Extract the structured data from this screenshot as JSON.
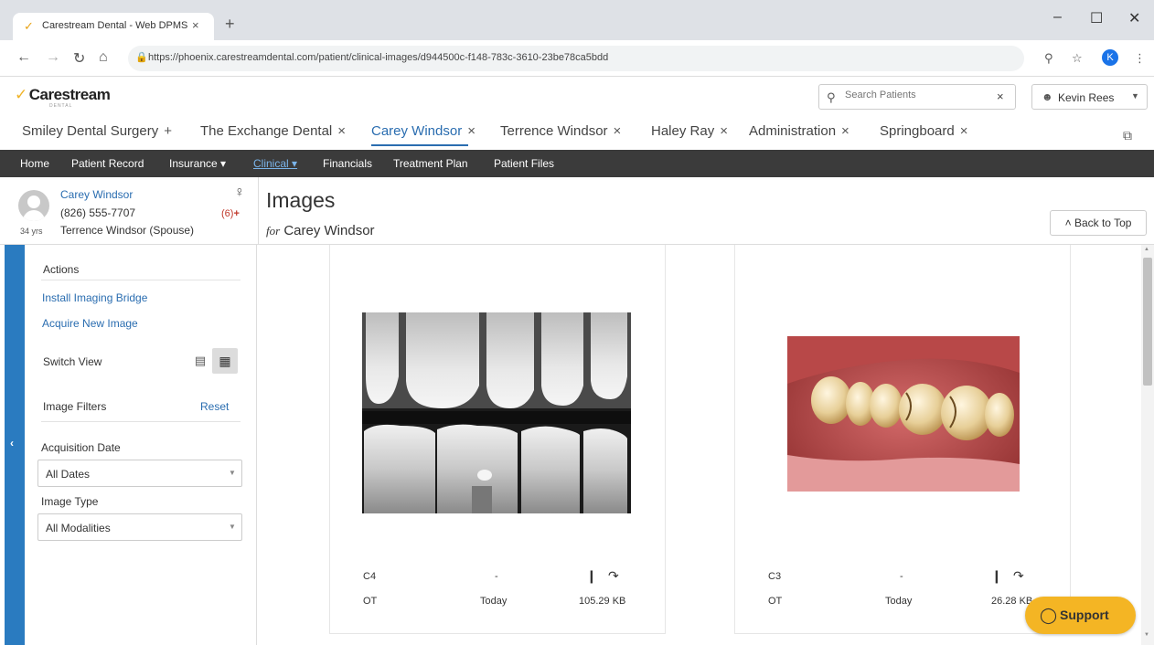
{
  "browser": {
    "tab_title": "Carestream Dental - Web DPMS",
    "tab_close": "×",
    "new_tab": "+",
    "url": "https://phoenix.carestreamdental.com/patient/clinical-images/d944500c-f148-783c-3610-23be78ca5bdd",
    "profile_initial": "K",
    "minimize": "–",
    "maximize": "☐",
    "close": "✕"
  },
  "header": {
    "logo_text": "Carestream",
    "logo_sub": "DENTAL",
    "search_placeholder": "Search Patients",
    "search_clear": "×",
    "user_name": "Kevin Rees"
  },
  "patient_tabs": [
    {
      "label": "Smiley Dental Surgery",
      "action": "+"
    },
    {
      "label": "The Exchange Dental",
      "action": "×"
    },
    {
      "label": "Carey Windsor",
      "action": "×"
    },
    {
      "label": "Terrence Windsor",
      "action": "×"
    },
    {
      "label": "Haley Ray",
      "action": "×"
    },
    {
      "label": "Administration",
      "action": "×"
    },
    {
      "label": "Springboard",
      "action": "×"
    }
  ],
  "nav": {
    "home": "Home",
    "patient_record": "Patient Record",
    "insurance": "Insurance ▾",
    "clinical": "Clinical ▾",
    "financials": "Financials",
    "treatment_plan": "Treatment Plan",
    "patient_files": "Patient Files"
  },
  "patient": {
    "name": "Carey Windsor",
    "phone": "(826) 555-7707",
    "spouse": "Terrence Windsor (Spouse)",
    "age": "34 yrs",
    "alert_count": "(6)",
    "alert_mark": "+"
  },
  "page": {
    "title": "Images",
    "for_label": "for",
    "for_name": "Carey Windsor",
    "back_to_top": "Back to Top"
  },
  "sidebar": {
    "actions_heading": "Actions",
    "install_bridge": "Install Imaging Bridge",
    "acquire_image": "Acquire New Image",
    "switch_view": "Switch View",
    "image_filters": "Image Filters",
    "reset": "Reset",
    "acq_date_label": "Acquisition Date",
    "acq_date_value": "All Dates",
    "image_type_label": "Image Type",
    "image_type_value": "All Modalities"
  },
  "images": [
    {
      "code": "C4",
      "dash": "-",
      "type": "OT",
      "date": "Today",
      "size": "105.29 KB"
    },
    {
      "code": "C3",
      "dash": "-",
      "type": "OT",
      "date": "Today",
      "size": "26.28 KB"
    }
  ],
  "support": {
    "label": "Support"
  },
  "colors": {
    "accent": "#2a6db0",
    "navbar": "#3b3b3b",
    "support": "#f4b524",
    "sidebar_strip": "#2a7bc0"
  }
}
